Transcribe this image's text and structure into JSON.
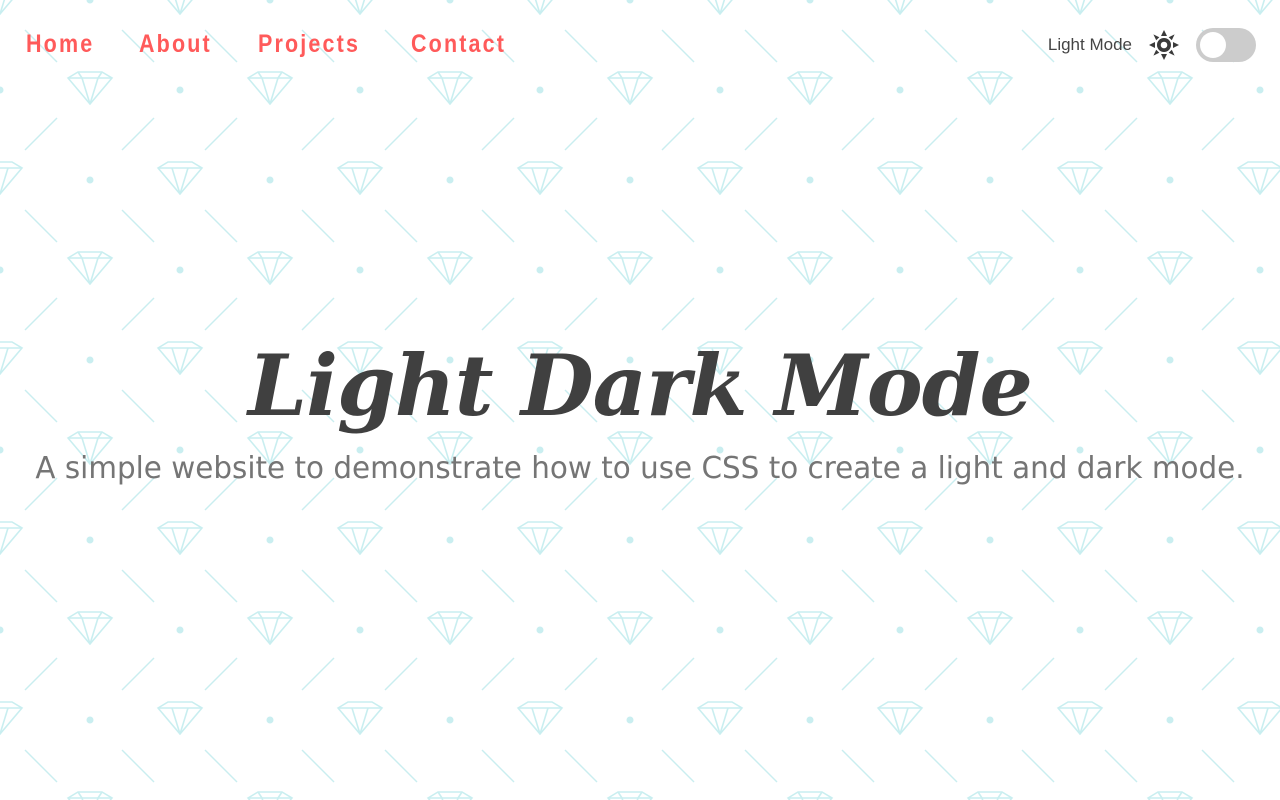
{
  "nav": {
    "links": [
      {
        "label": "Home"
      },
      {
        "label": "About"
      },
      {
        "label": "Projects"
      },
      {
        "label": "Contact"
      }
    ]
  },
  "theme_toggle": {
    "label": "Light Mode",
    "icon": "sun-icon",
    "checked": false
  },
  "hero": {
    "title": "Light Dark Mode",
    "subtitle": "A simple website to demonstrate how to use CSS to create a light and dark mode."
  },
  "colors": {
    "nav_link": "#ff5a5a",
    "title": "#404040",
    "subtitle": "#757575",
    "pattern": "#c9eef0",
    "toggle_track": "#cccccc",
    "toggle_knob": "#ffffff",
    "background": "#ffffff"
  }
}
